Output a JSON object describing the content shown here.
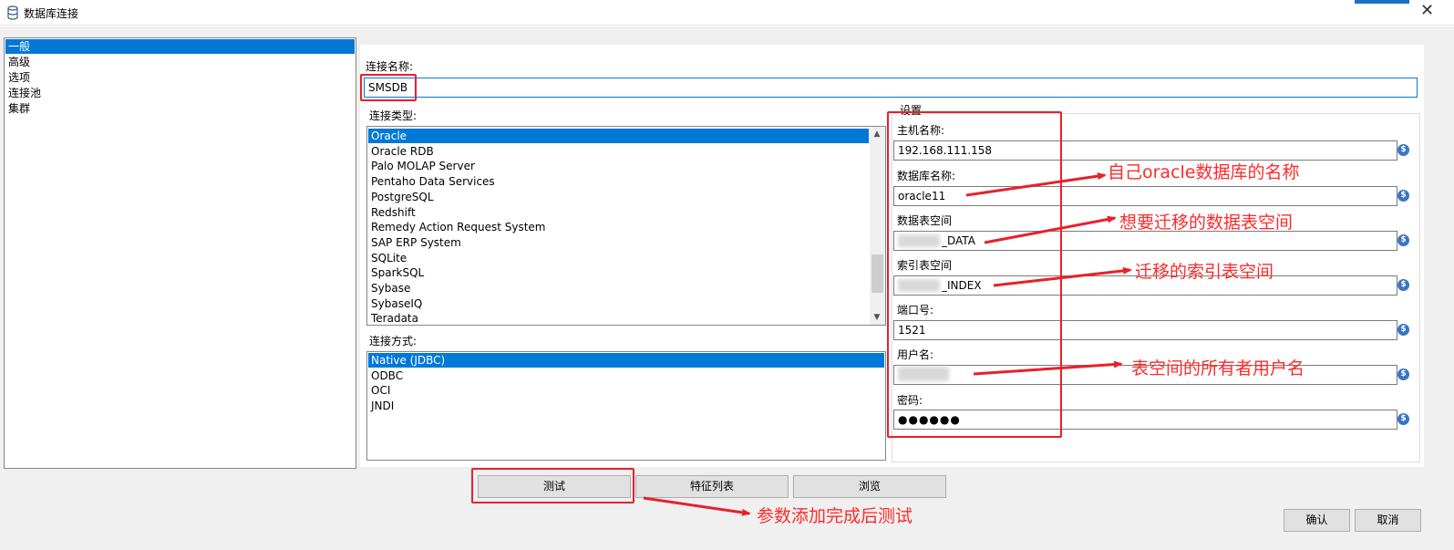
{
  "window": {
    "title": "数据库连接",
    "close_glyph": "✕"
  },
  "nav": {
    "items": [
      "一般",
      "高级",
      "选项",
      "连接池",
      "集群"
    ],
    "selected_index": 0
  },
  "general": {
    "connection_name_label": "连接名称:",
    "connection_name_value": "SMSDB",
    "connection_type_label": "连接类型:",
    "connection_types": [
      "Oracle",
      "Oracle RDB",
      "Palo MOLAP Server",
      "Pentaho Data Services",
      "PostgreSQL",
      "Redshift",
      "Remedy Action Request System",
      "SAP ERP System",
      "SQLite",
      "SparkSQL",
      "Sybase",
      "SybaseIQ",
      "Teradata"
    ],
    "selected_connection_type": "Oracle",
    "access_label": "连接方式:",
    "access_methods": [
      "Native (JDBC)",
      "ODBC",
      "OCI",
      "JNDI"
    ],
    "selected_access_method": "Native (JDBC)"
  },
  "settings": {
    "label": "设置",
    "host_label": "主机名称:",
    "host_value": "192.168.111.158",
    "db_label": "数据库名称:",
    "db_value": "oracle11",
    "data_ts_label": "数据表空间",
    "data_ts_value": "_DATA",
    "index_ts_label": "索引表空间",
    "index_ts_value": "_INDEX",
    "port_label": "端口号:",
    "port_value": "1521",
    "user_label": "用户名:",
    "user_value": "",
    "password_label": "密码:",
    "password_value": "●●●●●●",
    "variable_icon": "dollar-diamond-icon"
  },
  "buttons": {
    "test": "测试",
    "feature_list": "特征列表",
    "explore": "浏览",
    "ok": "确认",
    "cancel": "取消"
  },
  "annotations": {
    "db_name": "自己oracle数据库的名称",
    "data_ts": "想要迁移的数据表空间",
    "index_ts": "迁移的索引表空间",
    "owner": "表空间的所有者用户名",
    "test": "参数添加完成后测试",
    "color": "#e8202a"
  }
}
